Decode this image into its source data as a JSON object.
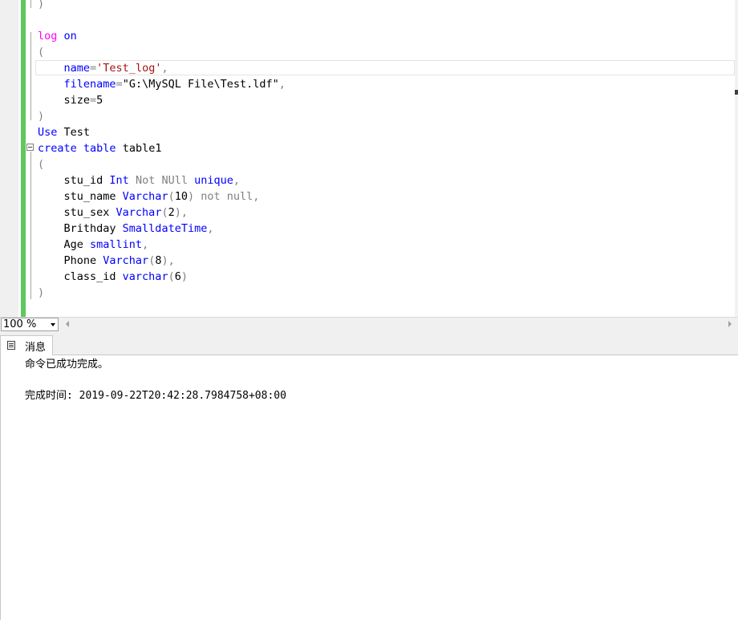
{
  "editor": {
    "lines": [
      [
        {
          "t": ")",
          "c": "gr"
        }
      ],
      [],
      [
        {
          "t": "log",
          "c": "fn"
        },
        {
          "t": " "
        },
        {
          "t": "on",
          "c": "kw"
        }
      ],
      [
        {
          "t": "(",
          "c": "gr"
        }
      ],
      [
        {
          "t": "    "
        },
        {
          "t": "name",
          "c": "kw"
        },
        {
          "t": "=",
          "c": "gr"
        },
        {
          "t": "'Test_log'",
          "c": "str"
        },
        {
          "t": ",",
          "c": "gr"
        }
      ],
      [
        {
          "t": "    "
        },
        {
          "t": "filename",
          "c": "kw"
        },
        {
          "t": "=",
          "c": "gr"
        },
        {
          "t": "\"G:\\MySQL File\\Test.ldf\""
        },
        {
          "t": ",",
          "c": "gr"
        }
      ],
      [
        {
          "t": "    size"
        },
        {
          "t": "=",
          "c": "gr"
        },
        {
          "t": "5"
        }
      ],
      [
        {
          "t": ")",
          "c": "gr"
        }
      ],
      [
        {
          "t": "Use",
          "c": "kw"
        },
        {
          "t": " Test"
        }
      ],
      [
        {
          "t": "create",
          "c": "kw"
        },
        {
          "t": " "
        },
        {
          "t": "table",
          "c": "kw"
        },
        {
          "t": " table1"
        }
      ],
      [
        {
          "t": "(",
          "c": "gr"
        }
      ],
      [
        {
          "t": "    stu_id "
        },
        {
          "t": "Int",
          "c": "kw"
        },
        {
          "t": " "
        },
        {
          "t": "Not NUll",
          "c": "gr"
        },
        {
          "t": " "
        },
        {
          "t": "unique",
          "c": "kw"
        },
        {
          "t": ",",
          "c": "gr"
        }
      ],
      [
        {
          "t": "    stu_name "
        },
        {
          "t": "Varchar",
          "c": "kw"
        },
        {
          "t": "(",
          "c": "gr"
        },
        {
          "t": "10"
        },
        {
          "t": ")",
          "c": "gr"
        },
        {
          "t": " "
        },
        {
          "t": "not null",
          "c": "gr"
        },
        {
          "t": ",",
          "c": "gr"
        }
      ],
      [
        {
          "t": "    stu_sex "
        },
        {
          "t": "Varchar",
          "c": "kw"
        },
        {
          "t": "(",
          "c": "gr"
        },
        {
          "t": "2"
        },
        {
          "t": ")",
          "c": "gr"
        },
        {
          "t": ",",
          "c": "gr"
        }
      ],
      [
        {
          "t": "    Brithday "
        },
        {
          "t": "SmalldateTime",
          "c": "kw"
        },
        {
          "t": ",",
          "c": "gr"
        }
      ],
      [
        {
          "t": "    Age "
        },
        {
          "t": "smallint",
          "c": "kw"
        },
        {
          "t": ",",
          "c": "gr"
        }
      ],
      [
        {
          "t": "    Phone "
        },
        {
          "t": "Varchar",
          "c": "kw"
        },
        {
          "t": "(",
          "c": "gr"
        },
        {
          "t": "8"
        },
        {
          "t": ")",
          "c": "gr"
        },
        {
          "t": ",",
          "c": "gr"
        }
      ],
      [
        {
          "t": "    class_id "
        },
        {
          "t": "varchar",
          "c": "kw"
        },
        {
          "t": "(",
          "c": "gr"
        },
        {
          "t": "6"
        },
        {
          "t": ")",
          "c": "gr"
        }
      ],
      [
        {
          "t": ")",
          "c": "gr"
        }
      ]
    ]
  },
  "statusbar": {
    "zoom_value": "100 %"
  },
  "results_tab": {
    "label": "消息"
  },
  "messages": {
    "line1": "命令已成功完成。",
    "line2": "完成时间: 2019-09-22T20:42:28.7984758+08:00"
  },
  "colors": {
    "keyword": "#0000ff",
    "operator": "#808080",
    "string": "#a31515",
    "function": "#ff00ff",
    "change_bar": "#5ec85e"
  }
}
